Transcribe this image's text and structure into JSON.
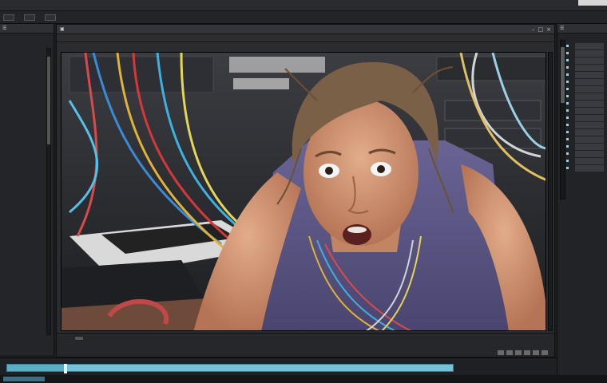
{
  "menubar": {
    "items": [
      "",
      "",
      "",
      "",
      "",
      "",
      "",
      ""
    ]
  },
  "toolbar": {
    "items": [
      "",
      "",
      "",
      ""
    ]
  },
  "left_panel": {
    "header": "",
    "tree": [
      "",
      "",
      "",
      "",
      "",
      "",
      "",
      "",
      "",
      "",
      "",
      "",
      "",
      "",
      "",
      "",
      "",
      "",
      "",
      "",
      "",
      "",
      "",
      "",
      ""
    ]
  },
  "viewer": {
    "tab_label": "",
    "subbar": [
      "",
      "",
      ""
    ],
    "status": [
      "",
      ""
    ]
  },
  "right_panel": {
    "header": "",
    "list": [
      "",
      "",
      "",
      "",
      "",
      "",
      "",
      "",
      "",
      "",
      "",
      "",
      "",
      "",
      "",
      "",
      "",
      ""
    ]
  },
  "timeline": {
    "progress": 0.13
  },
  "colors": {
    "accent": "#76c2d6",
    "panel": "#242528",
    "background": "#1b1c1e"
  }
}
